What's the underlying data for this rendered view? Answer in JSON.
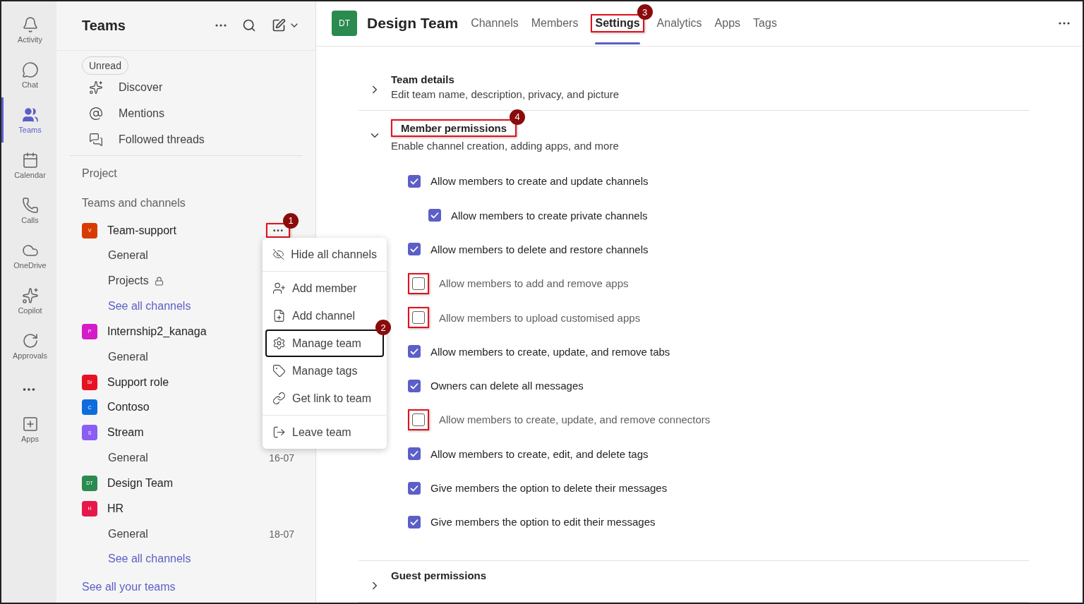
{
  "rail": {
    "items": [
      {
        "kind": "app",
        "label": "Activity",
        "selected": false
      },
      {
        "kind": "app",
        "label": "Chat",
        "selected": false
      },
      {
        "kind": "app",
        "label": "Teams",
        "selected": true
      },
      {
        "kind": "app",
        "label": "Calendar",
        "selected": false
      },
      {
        "kind": "app",
        "label": "Calls",
        "selected": false
      },
      {
        "kind": "app",
        "label": "OneDrive",
        "selected": false
      },
      {
        "kind": "app",
        "label": "Copilot",
        "selected": false
      },
      {
        "kind": "app",
        "label": "Approvals",
        "selected": false
      },
      {
        "kind": "more"
      },
      {
        "kind": "app",
        "label": "Apps",
        "selected": false
      }
    ]
  },
  "sidebar": {
    "title": "Teams",
    "filter_chip": "Unread",
    "nav_items": [
      "Discover",
      "Mentions",
      "Followed threads"
    ],
    "sections": [
      "Project",
      "Teams and channels"
    ],
    "teams": [
      {
        "name": "Team-support",
        "initials": "V",
        "color": "#d83b01",
        "callout": "1",
        "channels": [
          {
            "name": "General"
          },
          {
            "name": "Projects",
            "locked": true
          }
        ],
        "see_all": "See all channels"
      },
      {
        "name": "Internship2_kanaga",
        "initials": "P",
        "color": "#d41cc8",
        "channels": [
          {
            "name": "General"
          }
        ]
      },
      {
        "name": "Support role",
        "initials": "Sr",
        "color": "#e81123"
      },
      {
        "name": "Contoso",
        "initials": "C",
        "color": "#0f6cdd"
      },
      {
        "name": "Stream",
        "initials": "S",
        "color": "#8b5cf6",
        "channels": [
          {
            "name": "General",
            "date": "16-07"
          }
        ]
      },
      {
        "name": "Design Team",
        "initials": "DT",
        "color": "#2a8a4f"
      },
      {
        "name": "HR",
        "initials": "H",
        "color": "#e8174a",
        "channels": [
          {
            "name": "General",
            "date": "18-07"
          }
        ],
        "see_all": "See all channels"
      }
    ],
    "footer_link": "See all your teams"
  },
  "context_menu": {
    "items": [
      {
        "label": "Hide all channels",
        "focused": false,
        "divider_after": true
      },
      {
        "label": "Add member",
        "focused": false,
        "divider_after": false
      },
      {
        "label": "Add channel",
        "focused": false,
        "divider_after": false
      },
      {
        "label": "Manage team",
        "focused": true,
        "divider_after": false,
        "callout": "2"
      },
      {
        "label": "Manage tags",
        "focused": false,
        "divider_after": false
      },
      {
        "label": "Get link to team",
        "focused": false,
        "divider_after": true
      },
      {
        "label": "Leave team",
        "focused": false,
        "divider_after": false
      }
    ]
  },
  "header": {
    "avatar": "DT",
    "title": "Design Team",
    "tabs": [
      {
        "label": "Channels",
        "selected": false
      },
      {
        "label": "Members",
        "selected": false
      },
      {
        "label": "Settings",
        "selected": true,
        "callout": "3"
      },
      {
        "label": "Analytics",
        "selected": false
      },
      {
        "label": "Apps",
        "selected": false
      },
      {
        "label": "Tags",
        "selected": false
      }
    ]
  },
  "settings": {
    "sections": [
      {
        "title": "Team details",
        "subtitle": "Edit team name, description, privacy, and picture",
        "expanded": false
      },
      {
        "title": "Member permissions",
        "subtitle": "Enable channel creation, adding apps, and more",
        "expanded": true,
        "callout": "4",
        "options": [
          {
            "label": "Allow members to create and update channels",
            "checked": true,
            "children": [
              {
                "label": "Allow members to create private channels",
                "checked": true
              }
            ]
          },
          {
            "label": "Allow members to delete and restore channels",
            "checked": true
          },
          {
            "label": "Allow members to add and remove apps",
            "checked": false,
            "highlighted": true
          },
          {
            "label": "Allow members to upload customised apps",
            "checked": false,
            "highlighted": true
          },
          {
            "label": "Allow members to create, update, and remove tabs",
            "checked": true
          },
          {
            "label": "Owners can delete all messages",
            "checked": true
          },
          {
            "label": "Allow members to create, update, and remove connectors",
            "checked": false,
            "highlighted": true
          },
          {
            "label": "Allow members to create, edit, and delete tags",
            "checked": true
          },
          {
            "label": "Give members the option to delete their messages",
            "checked": true
          },
          {
            "label": "Give members the option to edit their messages",
            "checked": true
          }
        ]
      },
      {
        "title": "Guest permissions",
        "expanded": false
      }
    ]
  }
}
